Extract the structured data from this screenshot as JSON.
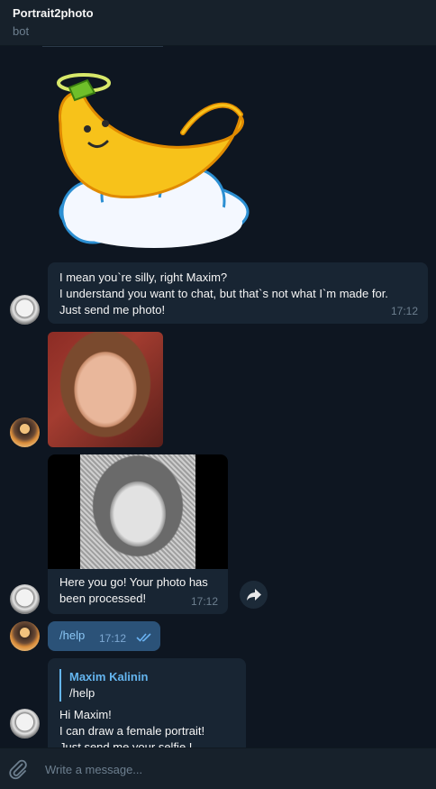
{
  "header": {
    "title": "Portrait2photo",
    "subtitle": "bot"
  },
  "messages": {
    "m1": {
      "lines": [
        "I mean you`re silly, right Maxim?",
        "I understand you want to chat, but that`s not what I`m made for.",
        "Just send me photo!"
      ],
      "time": "17:12"
    },
    "m2": {
      "caption_lines": [
        "Here you go! Your photo has",
        "been processed!"
      ],
      "time": "17:12"
    },
    "m3": {
      "text": "/help",
      "time": "17:12"
    },
    "m4": {
      "quote_name": "Maxim Kalinin",
      "quote_text": "/help",
      "lines": [
        "Hi Maxim!",
        "I can draw a female portrait!",
        "Just send me your selfie !"
      ]
    }
  },
  "composer": {
    "placeholder": "Write a message..."
  },
  "icons": {
    "attach": "paperclip-icon",
    "share": "share-arrow-icon",
    "read_status": "double-check-icon"
  },
  "colors": {
    "background": "#0e1621",
    "incoming_bubble": "#182533",
    "outgoing_bubble": "#2b5278",
    "accent": "#64b5ef"
  }
}
